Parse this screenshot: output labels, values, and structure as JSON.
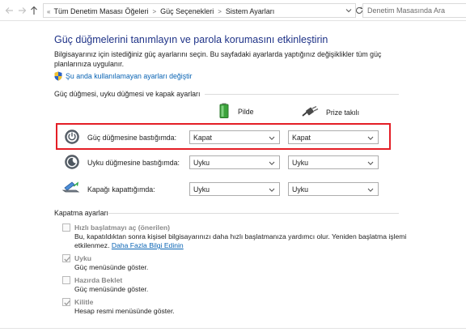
{
  "address_bar": {
    "back_icon": "arrow-left-icon",
    "forward_icon": "arrow-right-icon",
    "up_icon": "arrow-up-icon",
    "crumb_root": "«",
    "crumbs": [
      "Tüm Denetim Masası Öğeleri",
      "Güç Seçenekleri",
      "Sistem Ayarları"
    ],
    "search_placeholder": "Denetim Masasında Ara"
  },
  "page": {
    "title": "Güç düğmelerini tanımlayın ve parola korumasını etkinleştirin",
    "description": "Bilgisayarınız için istediğiniz güç ayarlarını seçin. Bu sayfadaki ayarlarda yaptığınız değişiklikler tüm güç planlarınıza uygulanır.",
    "admin_link": "Şu anda kullanılamayan ayarları değiştir"
  },
  "buttons_section": {
    "heading": "Güç düğmesi, uyku düğmesi ve kapak ayarları",
    "column_battery": "Pilde",
    "column_plugged": "Prize takılı",
    "rows": [
      {
        "label": "Güç düğmesine bastığımda:",
        "battery": "Kapat",
        "plugged": "Kapat"
      },
      {
        "label": "Uyku düğmesine bastığımda:",
        "battery": "Uyku",
        "plugged": "Uyku"
      },
      {
        "label": "Kapağı kapattığımda:",
        "battery": "Uyku",
        "plugged": "Uyku"
      }
    ]
  },
  "shutdown_section": {
    "heading": "Kapatma ayarları",
    "items": [
      {
        "label": "Hızlı başlatmayı aç (önerilen)",
        "checked": false,
        "desc": "Bu, kapatıldıktan sonra kişisel bilgisayarınızı daha hızlı başlatmanıza yardımcı olur. Yeniden başlatma işlemi etkilenmez.",
        "link": "Daha Fazla Bilgi Edinin"
      },
      {
        "label": "Uyku",
        "checked": true,
        "desc": "Güç menüsünde göster."
      },
      {
        "label": "Hazırda Beklet",
        "checked": false,
        "desc": "Güç menüsünde göster."
      },
      {
        "label": "Kilitle",
        "checked": true,
        "desc": "Hesap resmi menüsünde göster."
      }
    ]
  },
  "colors": {
    "title": "#1e3287",
    "link": "#0a64b4",
    "highlight_border": "#e41e26"
  }
}
